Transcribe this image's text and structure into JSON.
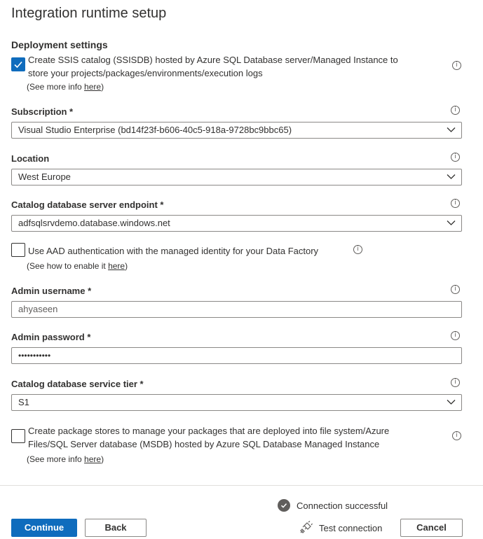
{
  "title": "Integration runtime setup",
  "section_title": "Deployment settings",
  "ssis_catalog": {
    "checked": true,
    "line1": "Create SSIS catalog (SSISDB) hosted by Azure SQL Database server/Managed Instance to",
    "line2": "store your projects/packages/environments/execution logs",
    "more_prefix": "(See more info ",
    "more_link": "here",
    "more_suffix": ")"
  },
  "subscription": {
    "label": "Subscription *",
    "value": "Visual Studio Enterprise (bd14f23f-b606-40c5-918a-9728bc9bbc65)"
  },
  "location": {
    "label": "Location",
    "value": "West Europe"
  },
  "endpoint": {
    "label": "Catalog database server endpoint *",
    "value": "adfsqlsrvdemo.database.windows.net"
  },
  "aad": {
    "checked": false,
    "text": "Use AAD authentication with the managed identity for your Data Factory",
    "how_prefix": "(See how to enable it ",
    "how_link": "here",
    "how_suffix": ")"
  },
  "admin_username": {
    "label": "Admin username *",
    "value": "ahyaseen"
  },
  "admin_password": {
    "label": "Admin password *",
    "value": "•••••••••••"
  },
  "service_tier": {
    "label": "Catalog database service tier *",
    "value": "S1"
  },
  "package_stores": {
    "checked": false,
    "line1": "Create package stores to manage your packages that are deployed into file system/Azure",
    "line2": "Files/SQL Server database (MSDB) hosted by Azure SQL Database Managed Instance",
    "more_prefix": "(See more info ",
    "more_link": "here",
    "more_suffix": ")"
  },
  "info_glyph": "i",
  "status": {
    "text": "Connection successful",
    "icon": "check-circle-icon"
  },
  "footer": {
    "continue": "Continue",
    "back": "Back",
    "test_connection": "Test connection",
    "cancel": "Cancel"
  },
  "colors": {
    "accent": "#0f6cbd",
    "text": "#323130",
    "border": "#8a8886"
  }
}
